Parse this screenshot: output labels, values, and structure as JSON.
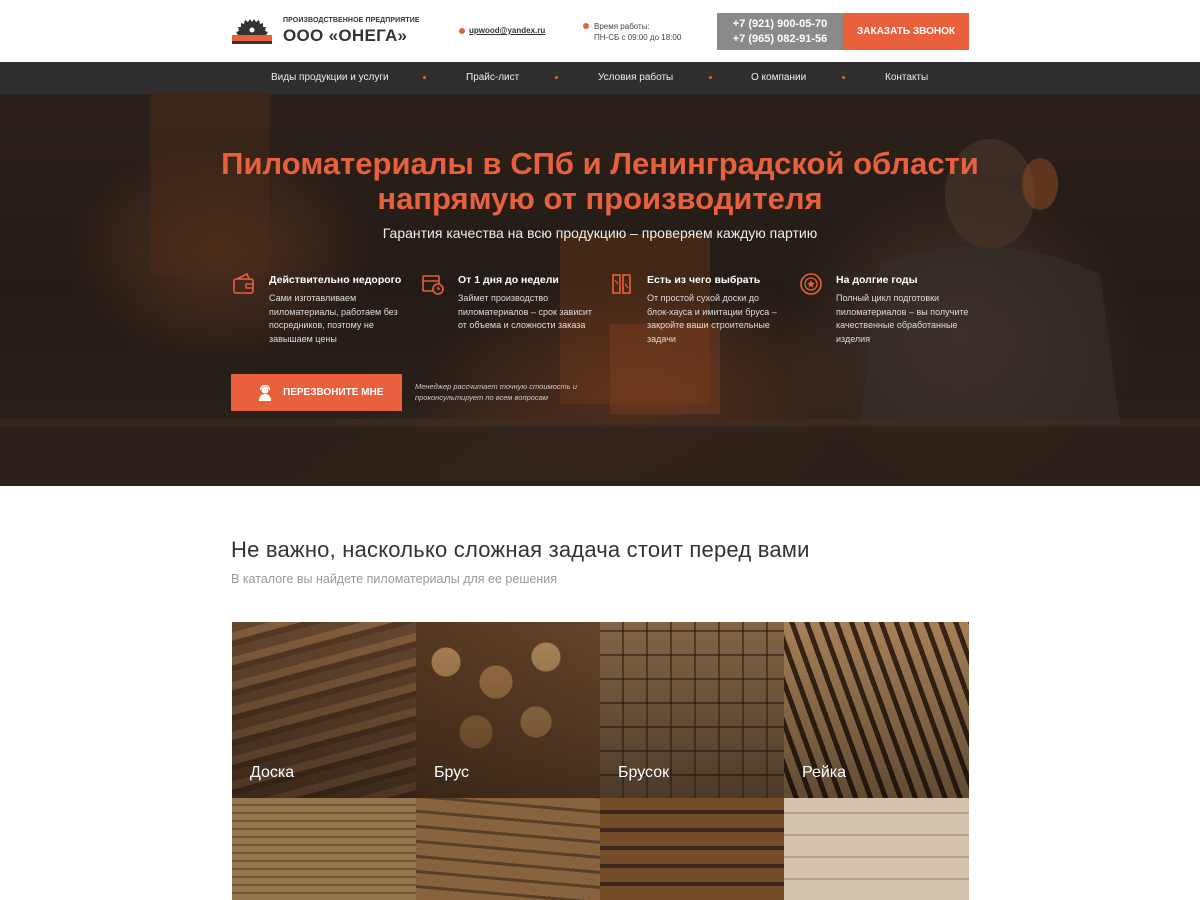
{
  "header": {
    "company_tag": "ПРОИЗВОДСТВЕННОЕ ПРЕДПРИЯТИЕ",
    "company_name": "ООО «ОНЕГА»",
    "email": "upwood@yandex.ru",
    "hours_label": "Время работы:",
    "hours_value": "ПН-СБ с 09:00 до 18:00",
    "phone_1": "+7 (921) 900-05-70",
    "phone_2": "+7 (965) 082-91-56",
    "callback_label": "ЗАКАЗАТЬ ЗВОНОК"
  },
  "nav": {
    "items": [
      {
        "label": "Виды продукции и услуги"
      },
      {
        "label": "Прайс-лист"
      },
      {
        "label": "Условия работы"
      },
      {
        "label": "О компании"
      },
      {
        "label": "Контакты"
      }
    ]
  },
  "hero": {
    "title_line1": "Пиломатериалы в СПб и Ленинградской области",
    "title_line2": "напрямую от производителя",
    "subtitle": "Гарантия качества на всю продукцию – проверяем каждую партию",
    "features": [
      {
        "icon": "wallet-icon",
        "title": "Действительно недорого",
        "text": "Сами изготавливаем пиломатериалы, работаем без посредников, поэтому не завышаем цены"
      },
      {
        "icon": "calendar-icon",
        "title": "От 1 дня до недели",
        "text": "Займет производство пиломатериалов – срок зависит от объема и сложности заказа"
      },
      {
        "icon": "planks-icon",
        "title": "Есть из чего выбрать",
        "text": "От простой сухой доски до блок-хауса и имитации бруса – закройте ваши строительные задачи"
      },
      {
        "icon": "award-icon",
        "title": "На долгие годы",
        "text": "Полный цикл подготовки пиломатериалов – вы получите качественные обработанные изделия"
      }
    ],
    "cta_label": "ПЕРЕЗВОНИТЕ МНЕ",
    "cta_note": "Менеджер рассчитает точную стоимость и проконсультирует по всем вопросам"
  },
  "catalog": {
    "title": "Не важно, насколько сложная задача стоит перед вами",
    "subtitle": "В каталоге вы найдете пиломатериалы для ее решения",
    "items": [
      {
        "label": "Доска"
      },
      {
        "label": "Брус"
      },
      {
        "label": "Брусок"
      },
      {
        "label": "Рейка"
      }
    ]
  },
  "colors": {
    "accent": "#e8603c",
    "nav_bg": "#2e2e2e",
    "phone_bg": "#8a8a8a"
  }
}
